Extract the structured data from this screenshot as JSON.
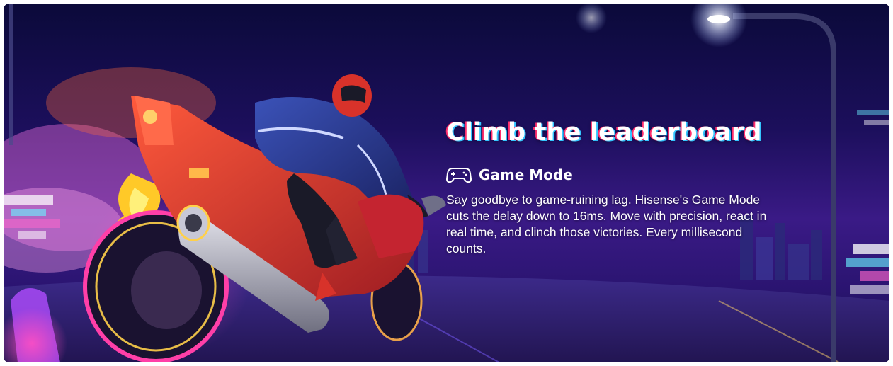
{
  "banner": {
    "headline": "Climb the leaderboard",
    "feature": {
      "icon": "gamepad-icon",
      "title": "Game Mode"
    },
    "description": "Say goodbye to game-ruining lag. Hisense's Game Mode cuts the delay down to 16ms. Move with precision, react in real time, and clinch those victories. Every millisecond counts."
  },
  "colors": {
    "sky_dark": "#0b0a3a",
    "sky_purple": "#3a1a86",
    "neon_pink": "#ff2f6d",
    "neon_cyan": "#34c6ff",
    "bike_red": "#d8322a",
    "jacket_blue": "#2a3a8c",
    "text": "#ffffff"
  }
}
